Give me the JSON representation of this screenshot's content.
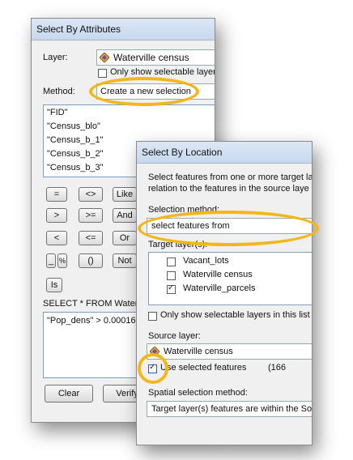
{
  "attr_dialog": {
    "title": "Select By Attributes",
    "layer_label": "Layer:",
    "layer_value": "Waterville census",
    "only_selectable_label": "Only show selectable layers",
    "method_label": "Method:",
    "method_value": "Create a new selection",
    "fields": [
      "\"FID\"",
      "\"Census_blo\"",
      "\"Census_b_1\"",
      "\"Census_b_2\"",
      "\"Census_b_3\""
    ],
    "operators": [
      [
        "=",
        "<>",
        "Like"
      ],
      [
        ">",
        ">=",
        "And"
      ],
      [
        "<",
        "<=",
        "Or"
      ],
      [
        "_",
        "%",
        "()",
        "Not"
      ]
    ],
    "is_button": "Is",
    "sql_prefix": "SELECT * FROM Waterv",
    "sql_expression": "\"Pop_dens\" > 0.00016",
    "clear_button": "Clear",
    "verify_button": "Verify"
  },
  "loc_dialog": {
    "title": "Select By Location",
    "description_line1": "Select features from one or more target la",
    "description_line2": "relation to the features in the source laye",
    "selection_method_label": "Selection method:",
    "selection_method_value": "select features from",
    "target_layers_label": "Target layer(s):",
    "target_layers": [
      {
        "label": "Vacant_lots",
        "checked": false
      },
      {
        "label": "Waterville census",
        "checked": false
      },
      {
        "label": "Waterville_parcels",
        "checked": true
      }
    ],
    "only_selectable_label": "Only show selectable layers in this list",
    "source_layer_label": "Source layer:",
    "source_layer_value": "Waterville census",
    "use_selected_label": "Use selected features",
    "selected_count": "(166",
    "spatial_method_label": "Spatial selection method:",
    "spatial_method_value": "Target layer(s) features are within the So"
  },
  "colors": {
    "highlight": "#f2b71a",
    "title_bar": "#c7d8ee"
  }
}
